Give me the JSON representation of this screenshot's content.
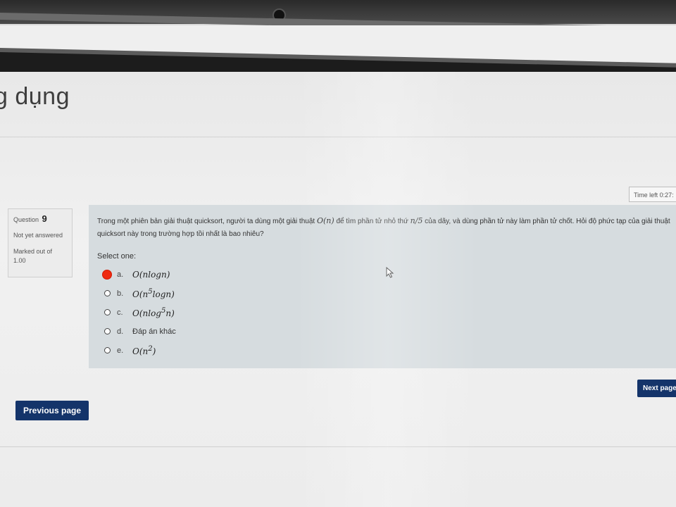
{
  "page": {
    "heading": "g dụng",
    "time_left": "Time left 0:27:",
    "colors": {
      "button": "#14346a",
      "question_bg": "#d6dcdf",
      "selected_marker": "#ef2a10"
    }
  },
  "question_info": {
    "label": "Question",
    "number": "9",
    "state": "Not yet answered",
    "marks_label": "Marked out of",
    "marks_value": "1.00"
  },
  "question": {
    "text_part1": "Trong một phiên bản giải thuật quicksort, người ta dùng một giải thuật",
    "math1": "O(n)",
    "text_part2": "để tìm phần tử nhỏ thứ",
    "math2": "n/5",
    "text_part3": "của dãy, và dùng phần tử này làm phần tử chốt. Hỏi độ phức tạp của giải thuật quicksort này trong trường hợp tồi nhất là bao nhiêu?",
    "select_label": "Select one:",
    "answers": [
      {
        "letter": "a.",
        "text": "O(nlogn)",
        "selected": true
      },
      {
        "letter": "b.",
        "text_pre": "O(n",
        "sup": "5",
        "text_post": "logn)",
        "selected": false
      },
      {
        "letter": "c.",
        "text_pre": "O(nlog",
        "sup": "5",
        "text_post": "n)",
        "selected": false
      },
      {
        "letter": "d.",
        "text": "Đáp án khác",
        "selected": false
      },
      {
        "letter": "e.",
        "text_pre": "O(n",
        "sup": "2",
        "text_post": ")",
        "selected": false
      }
    ]
  },
  "nav": {
    "next_label": "Next page",
    "prev_label": "Previous page"
  }
}
